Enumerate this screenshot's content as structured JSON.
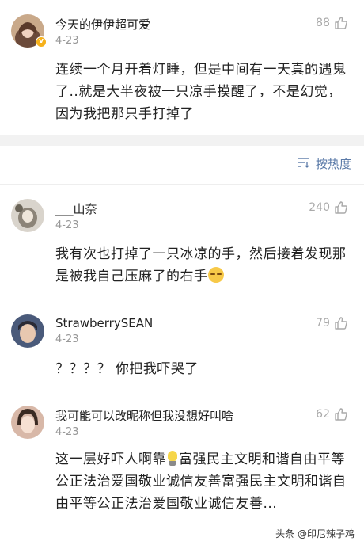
{
  "comments": [
    {
      "username": "今天的伊伊超可爱",
      "date": "4-23",
      "likes": "88",
      "text": "连续一个月开着灯睡，但是中间有一天真的遇鬼了..就是大半夜被一只凉手摸醒了，不是幻觉，因为我把那只手打掉了",
      "avatar_color": "#c9a98a",
      "verified": true
    },
    {
      "username": "___山奈",
      "date": "4-23",
      "likes": "240",
      "text": "我有次也打掉了一只冰凉的手，然后接着发现那是被我自己压麻了的右手",
      "emoji": "sleepy-face-emoji",
      "avatar_color": "#8c8478"
    },
    {
      "username": "StrawberrySEAN",
      "date": "4-23",
      "likes": "79",
      "text": "？？？？ 你把我吓哭了",
      "avatar_color": "#4a5a7a"
    },
    {
      "username": "我可能可以改昵称但我没想好叫啥",
      "date": "4-23",
      "likes": "62",
      "text_before": "这一层好吓人啊靠",
      "emoji": "lightbulb-emoji",
      "text_after": "富强民主文明和谐自由平等公正法治爱国敬业诚信友善富强民主文明和谐自由平等公正法治爱国敬业诚信友善...",
      "avatar_color": "#d8b8a8"
    }
  ],
  "sort": {
    "label": "按热度",
    "icon": "sort-lines-icon"
  },
  "watermark": "头条 @印尼辣子鸡",
  "colors": {
    "link_blue": "#5a7aa8",
    "muted_gray": "#999999",
    "like_gray": "#aaaaaa",
    "band_gray": "#f2f2f2",
    "verified_gold": "#f6b11a"
  }
}
